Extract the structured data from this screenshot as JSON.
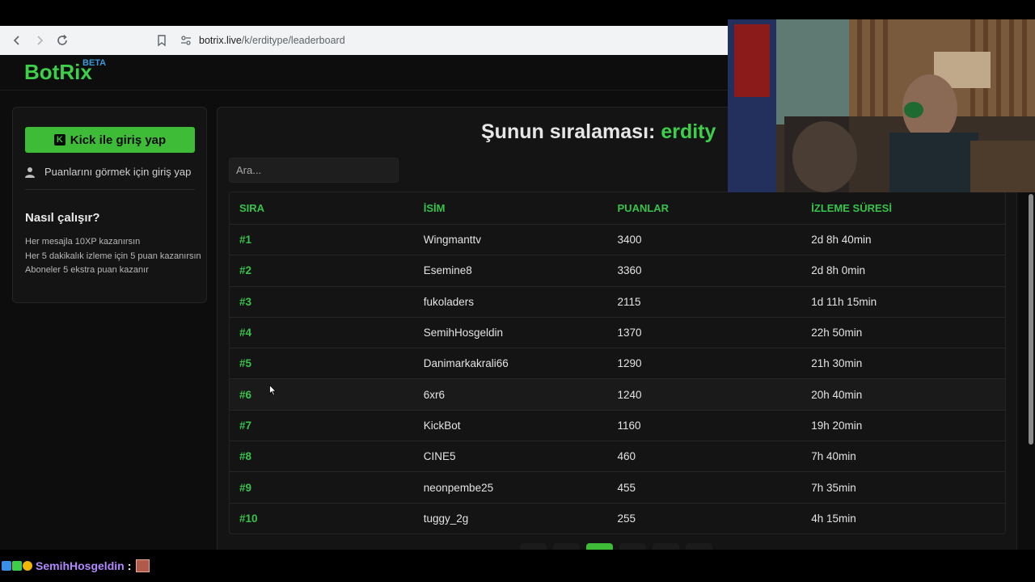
{
  "browser": {
    "url_domain": "botrix.live",
    "url_path": "/k/erditype/leaderboard"
  },
  "header": {
    "logo": "BotRix",
    "beta": "BETA"
  },
  "sidebar": {
    "login_button": "Kick ile giriş yap",
    "login_hint": "Puanlarını görmek için giriş yap",
    "how_title": "Nasıl çalışır?",
    "how_items": [
      "Her mesajla 10XP kazanırsın",
      "Her 5 dakikalık izleme için 5 puan kazanırsın",
      "Aboneler 5 ekstra puan kazanır"
    ]
  },
  "main": {
    "title_prefix": "Şunun sıralaması:",
    "title_user": "erdity",
    "search_placeholder": "Ara...",
    "columns": [
      "SIRA",
      "İSİM",
      "PUANLAR",
      "İZLEME SÜRESİ"
    ],
    "rows": [
      {
        "rank": "#1",
        "name": "Wingmanttv",
        "points": "3400",
        "watch": "2d 8h 40min"
      },
      {
        "rank": "#2",
        "name": "Esemine8",
        "points": "3360",
        "watch": "2d 8h 0min"
      },
      {
        "rank": "#3",
        "name": "fukoladers",
        "points": "2115",
        "watch": "1d 11h 15min"
      },
      {
        "rank": "#4",
        "name": "SemihHosgeldin",
        "points": "1370",
        "watch": "22h 50min"
      },
      {
        "rank": "#5",
        "name": "Danimarkakrali66",
        "points": "1290",
        "watch": "21h 30min"
      },
      {
        "rank": "#6",
        "name": "6xr6",
        "points": "1240",
        "watch": "20h 40min"
      },
      {
        "rank": "#7",
        "name": "KickBot",
        "points": "1160",
        "watch": "19h 20min"
      },
      {
        "rank": "#8",
        "name": "CINE5",
        "points": "460",
        "watch": "7h 40min"
      },
      {
        "rank": "#9",
        "name": "neonpembe25",
        "points": "455",
        "watch": "7h 35min"
      },
      {
        "rank": "#10",
        "name": "tuggy_2g",
        "points": "255",
        "watch": "4h 15min"
      }
    ]
  },
  "chat": {
    "username": "SemihHosgeldin",
    "colon": ":"
  },
  "colors": {
    "accent": "#3ecf4a",
    "background": "#0d0d0d",
    "panel": "#141414"
  }
}
